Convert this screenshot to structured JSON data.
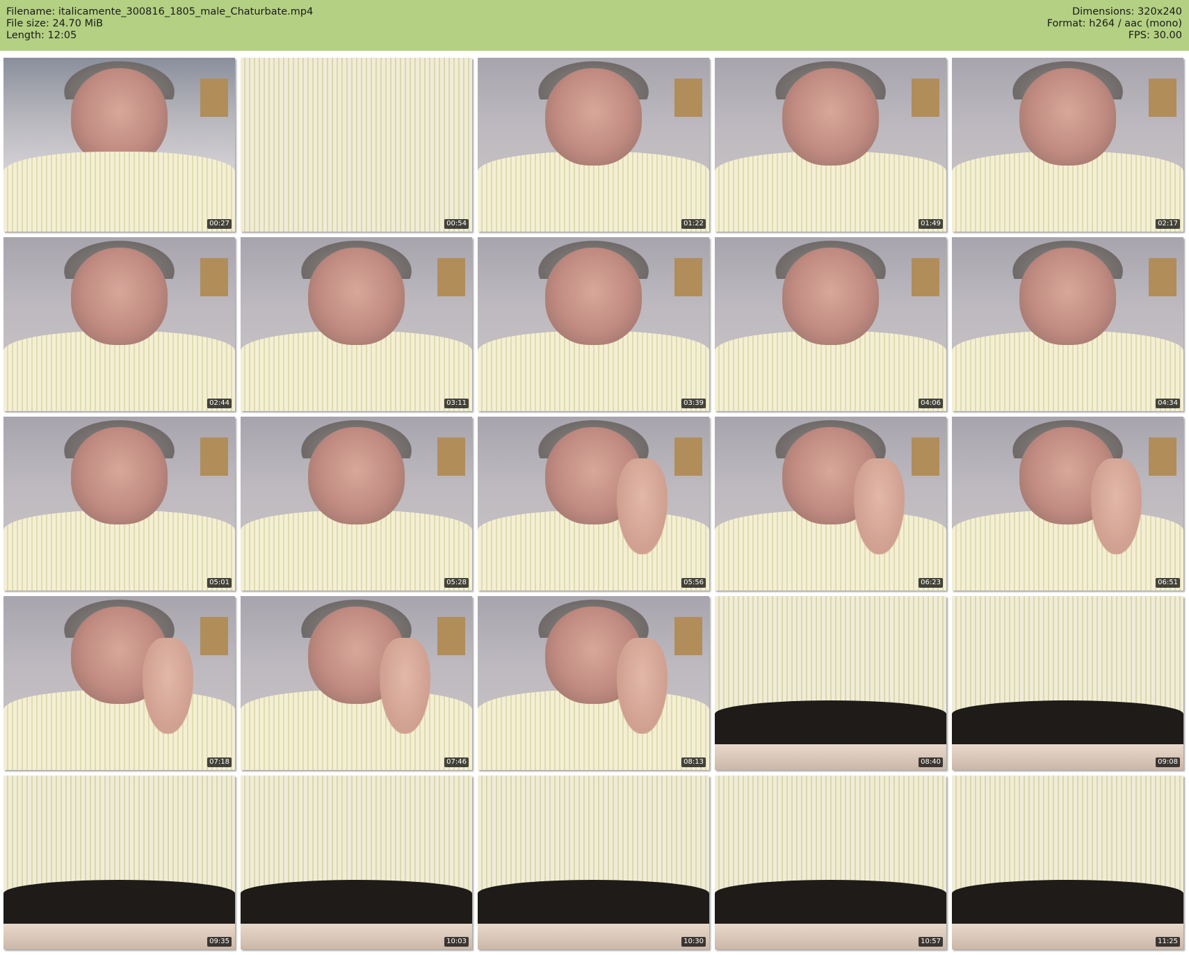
{
  "header": {
    "filename_line": "Filename: italicamente_300816_1805_male_Chaturbate.mp4",
    "filesize_line": "File size: 24.70 MiB",
    "length_line": "Length: 12:05",
    "dimensions_line": "Dimensions: 320x240",
    "format_line": "Format: h264 / aac (mono)",
    "fps_line": "FPS: 30.00",
    "background_color": "#b4d083"
  },
  "thumbnails": [
    {
      "time": "00:27",
      "scene": "wide"
    },
    {
      "time": "00:54",
      "scene": "shirt"
    },
    {
      "time": "01:22",
      "scene": "face"
    },
    {
      "time": "01:49",
      "scene": "face"
    },
    {
      "time": "02:17",
      "scene": "face"
    },
    {
      "time": "02:44",
      "scene": "face"
    },
    {
      "time": "03:11",
      "scene": "face"
    },
    {
      "time": "03:39",
      "scene": "face"
    },
    {
      "time": "04:06",
      "scene": "face"
    },
    {
      "time": "04:34",
      "scene": "face"
    },
    {
      "time": "05:01",
      "scene": "face"
    },
    {
      "time": "05:28",
      "scene": "face"
    },
    {
      "time": "05:56",
      "scene": "face-hand"
    },
    {
      "time": "06:23",
      "scene": "face-hand"
    },
    {
      "time": "06:51",
      "scene": "face-hand"
    },
    {
      "time": "07:18",
      "scene": "face-hand"
    },
    {
      "time": "07:46",
      "scene": "face-hand"
    },
    {
      "time": "08:13",
      "scene": "face-hand"
    },
    {
      "time": "08:40",
      "scene": "shirt-desk"
    },
    {
      "time": "09:08",
      "scene": "shirt-desk"
    },
    {
      "time": "09:35",
      "scene": "shirt-desk"
    },
    {
      "time": "10:03",
      "scene": "shirt-desk"
    },
    {
      "time": "10:30",
      "scene": "shirt-desk"
    },
    {
      "time": "10:57",
      "scene": "shirt-desk"
    },
    {
      "time": "11:25",
      "scene": "shirt-desk"
    }
  ]
}
